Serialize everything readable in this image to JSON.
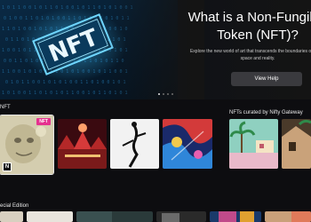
{
  "hero": {
    "title": "What is a Non-Fungible Token (NFT)?",
    "subtitle": "Explore the new world of art that transcends the boundaries of digital space and reality.",
    "art_text": "NFT",
    "button_label": "View Help",
    "slides": 4,
    "active_slide": 1
  },
  "sections": {
    "left_title": "NFT",
    "right_title": "NFTs curated by Nifty Gateway",
    "bottom_title": "ecial Edition"
  },
  "tiles": {
    "featured_badge": "NFT",
    "featured_logo": "N"
  },
  "colors": {
    "badge": "#e5318f",
    "hero_text": "#1f8fd6"
  }
}
